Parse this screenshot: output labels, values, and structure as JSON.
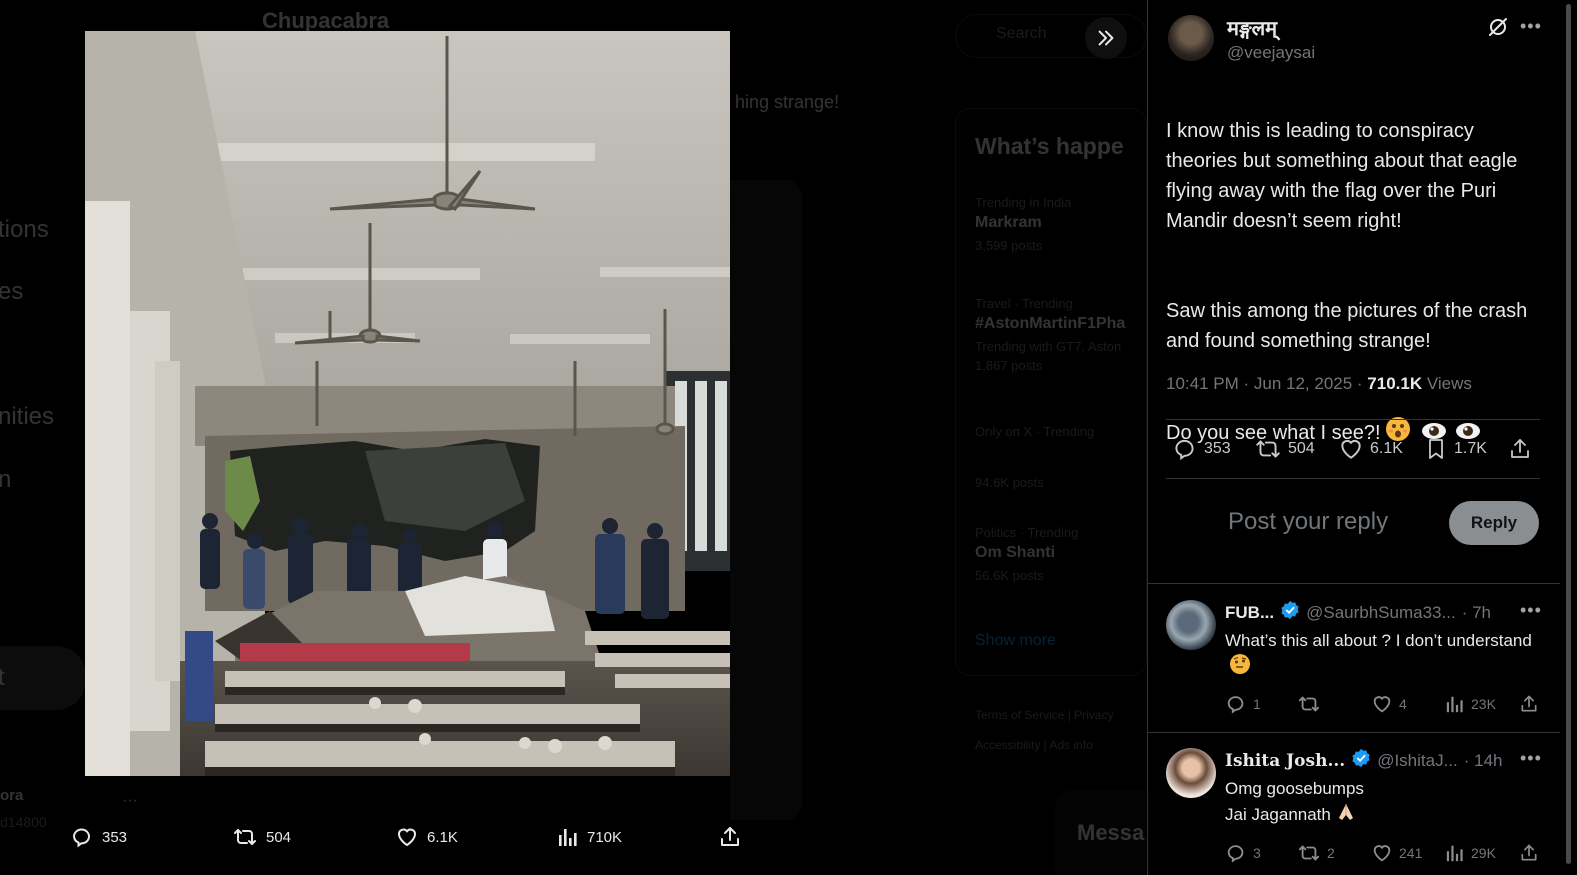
{
  "background": {
    "header_title": "Chupacabra",
    "nav_items": [
      "tions",
      "es",
      "nities",
      "n",
      "t"
    ],
    "snippet_text": "hing strange!",
    "profile_name": "ora",
    "profile_handle": "d14800",
    "search_placeholder": "Search",
    "trends_heading": "What’s happe",
    "trends": [
      {
        "meta": "Trending in India",
        "topic": "Markram",
        "count": "3,599 posts"
      },
      {
        "meta": "Travel · Trending",
        "topic": "#AstonMartinF1Pha",
        "count": "Trending with GT7, Aston"
      },
      {
        "meta": "",
        "topic": "",
        "count": "1,867 posts"
      },
      {
        "meta": "Only on X · Trending",
        "topic": "",
        "count": "94.6K posts"
      },
      {
        "meta": "Politics · Trending",
        "topic": "Om Shanti",
        "count": "56.6K posts"
      }
    ],
    "show_more": "Show more",
    "footer": [
      "Terms of Service  |  Privacy",
      "Accessibility  |  Ads info"
    ],
    "messages_label": "Messa"
  },
  "media_actions": {
    "replies": "353",
    "reposts": "504",
    "likes": "6.1K",
    "views": "710K"
  },
  "tweet": {
    "author_name": "मङ्गलम्",
    "author_handle": "@veejaysai",
    "paragraph_1": "I know this is leading to conspiracy theories but something about that eagle flying away with the flag over the Puri Mandir doesn’t seem right!",
    "paragraph_2": "Saw this among the pictures of the crash and found something strange!",
    "paragraph_3": "Do you see what I see?!",
    "time": "10:41 PM · Jun 12, 2025 · ",
    "views_count": "710.1K",
    "views_label": " Views",
    "stats": {
      "replies": "353",
      "reposts": "504",
      "likes": "6.1K",
      "bookmarks": "1.7K"
    }
  },
  "reply_box": {
    "placeholder": "Post your reply",
    "button": "Reply"
  },
  "replies": [
    {
      "name": "FUB...",
      "handle": "@SaurbhSuma33...",
      "age": "· 7h",
      "text": "What’s this all about ? I don’t understand",
      "replies": "1",
      "reposts": "",
      "likes": "4",
      "views": "23K"
    },
    {
      "name": "Ishita Josh...",
      "handle": "@IshitaJ...",
      "age": "· 14h",
      "text": "Omg goosebumps\nJai Jagannath",
      "replies": "3",
      "reposts": "2",
      "likes": "241",
      "views": "29K"
    }
  ],
  "colors": {
    "background": "#000000",
    "text": "#e7e9ea",
    "muted": "#71767b",
    "border": "#2f3336",
    "verified": "#1d9bf0",
    "reply_button": "#8b8e91"
  }
}
